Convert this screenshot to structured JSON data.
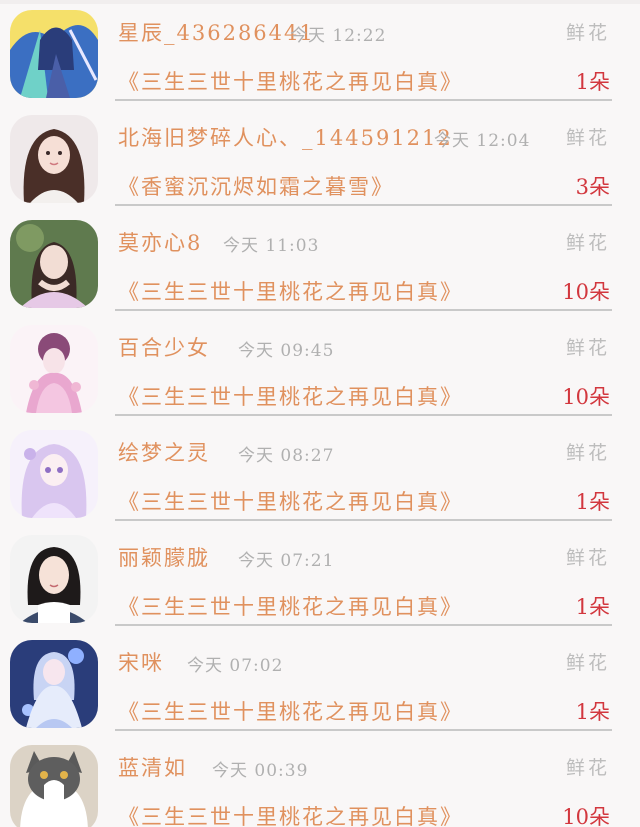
{
  "colors": {
    "background": "#f9f7f7",
    "name_orange": "#e0915e",
    "count_red": "#d2373e",
    "muted_gray": "#b0b0b0",
    "divider": "#c9c9c9"
  },
  "items": [
    {
      "name": "星辰_436286441",
      "time": "今天 12:22",
      "gift_type": "鲜花",
      "gift_title": "《三生三世十里桃花之再见白真》",
      "count": "1朵",
      "avatar_icon": "anime-swordsman-avatar"
    },
    {
      "name": "北海旧梦碎人心、_144591212",
      "time": "今天 12:04",
      "gift_type": "鲜花",
      "gift_title": "《香蜜沉沉烬如霜之暮雪》",
      "count": "3朵",
      "avatar_icon": "girl-portrait-avatar"
    },
    {
      "name": "莫亦心8",
      "time": "今天 11:03",
      "gift_type": "鲜花",
      "gift_title": "《三生三世十里桃花之再见白真》",
      "count": "10朵",
      "avatar_icon": "hanfu-girl-avatar"
    },
    {
      "name": "百合少女",
      "time": "今天 09:45",
      "gift_type": "鲜花",
      "gift_title": "《三生三世十里桃花之再见白真》",
      "count": "10朵",
      "avatar_icon": "pink-anime-girl-avatar"
    },
    {
      "name": "绘梦之灵",
      "time": "今天 08:27",
      "gift_type": "鲜花",
      "gift_title": "《三生三世十里桃花之再见白真》",
      "count": "1朵",
      "avatar_icon": "lavender-anime-girl-avatar"
    },
    {
      "name": "丽颖朦胧",
      "time": "今天 07:21",
      "gift_type": "鲜花",
      "gift_title": "《三生三世十里桃花之再见白真》",
      "count": "1朵",
      "avatar_icon": "woman-portrait-avatar"
    },
    {
      "name": "宋咪",
      "time": "今天 07:02",
      "gift_type": "鲜花",
      "gift_title": "《三生三世十里桃花之再见白真》",
      "count": "1朵",
      "avatar_icon": "blue-anime-girl-avatar"
    },
    {
      "name": "蓝清如",
      "time": "今天 00:39",
      "gift_type": "鲜花",
      "gift_title": "《三生三世十里桃花之再见白真》",
      "count": "10朵",
      "avatar_icon": "cat-avatar"
    }
  ]
}
